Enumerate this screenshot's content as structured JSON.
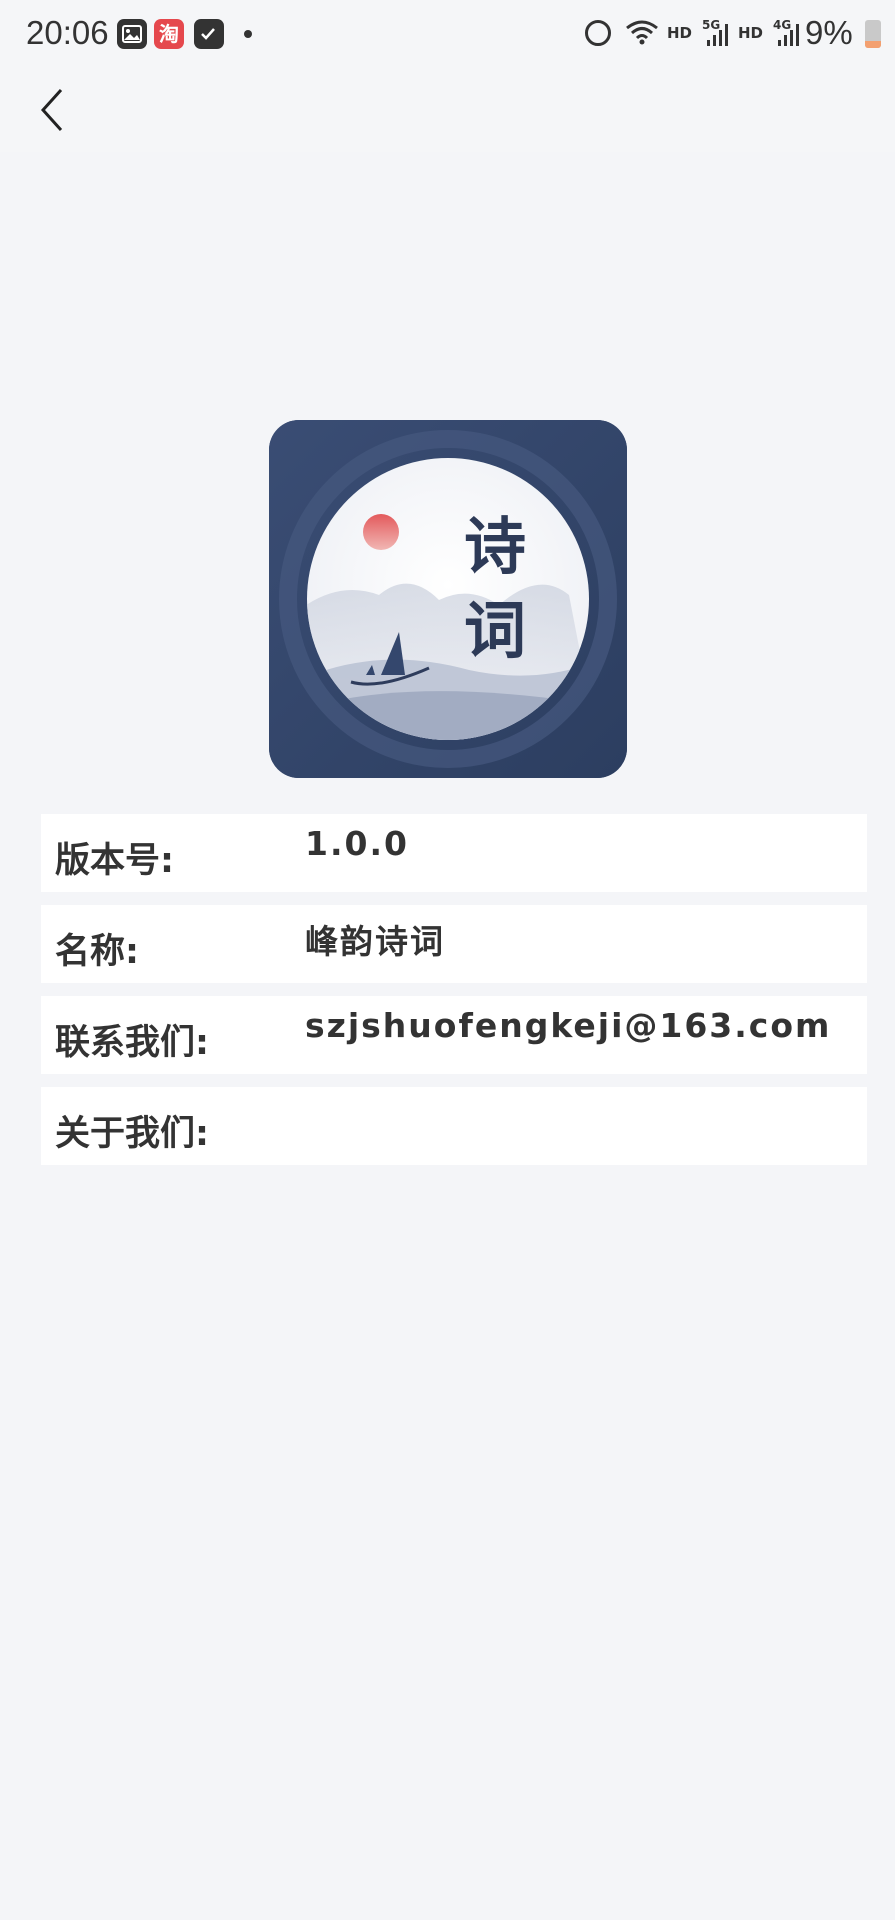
{
  "status_bar": {
    "time": "20:06",
    "notif_taobao": "淘",
    "hd_1": "HD",
    "gen_1": "5G",
    "hd_2": "HD",
    "gen_2": "4G",
    "battery": "9%"
  },
  "nav": {
    "back_icon": "chevron-left-icon"
  },
  "logo": {
    "char_1": "诗",
    "char_2": "词",
    "sun_color": "#d7474b",
    "bg_color": "#34476d"
  },
  "info": {
    "version_label": "版本号:",
    "version_value": "1.0.0",
    "name_label": "名称:",
    "name_value": "峰韵诗词",
    "contact_label": "联系我们:",
    "contact_value": "szjshuofengkeji@163.com",
    "about_label": "关于我们:"
  }
}
